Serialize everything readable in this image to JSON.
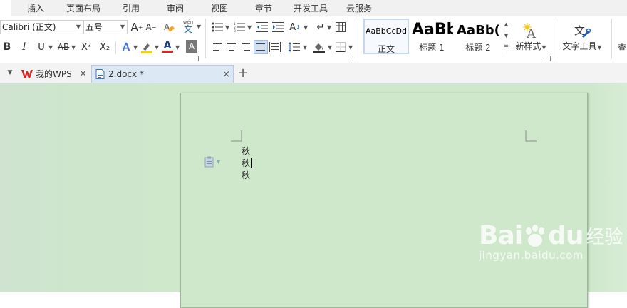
{
  "menubar": {
    "items": [
      "插入",
      "页面布局",
      "引用",
      "审阅",
      "视图",
      "章节",
      "开发工具",
      "云服务"
    ]
  },
  "ribbon": {
    "font_name": "Calibri (正文)",
    "font_size": "五号",
    "grow_font": "A",
    "shrink_font": "A",
    "phonetic_top": "wén",
    "phonetic_main": "文",
    "bold": "B",
    "italic": "I",
    "underline": "U",
    "strikethrough": "AB",
    "superscript": "X²",
    "subscript": "X₂",
    "text_effect": "A",
    "highlight": "A",
    "font_color": "A",
    "char_shading": "A",
    "text_direction": "A",
    "style_gallery": [
      {
        "sample": "AaBbCcDd",
        "name": "正文"
      },
      {
        "sample": "AaBb",
        "name": "标题 1"
      },
      {
        "sample": "AaBb(",
        "name": "标题 2"
      }
    ],
    "new_style_label": "新样式",
    "text_tools_label": "文字工具",
    "find_label": "查",
    "colors": {
      "font_color_bar": "#e0261b",
      "highlight_bar": "#f5d400",
      "shading_bar": "#333333"
    }
  },
  "tabs": [
    {
      "label": "我的WPS",
      "icon": "wps-logo-icon"
    },
    {
      "label": "2.docx *",
      "icon": "document-icon"
    }
  ],
  "document": {
    "lines": [
      "秋",
      "秋",
      "秋"
    ]
  },
  "watermark": {
    "brand": "Bai",
    "brand_suffix": "du",
    "cn": "经验",
    "url": "jingyan.baidu.com"
  }
}
